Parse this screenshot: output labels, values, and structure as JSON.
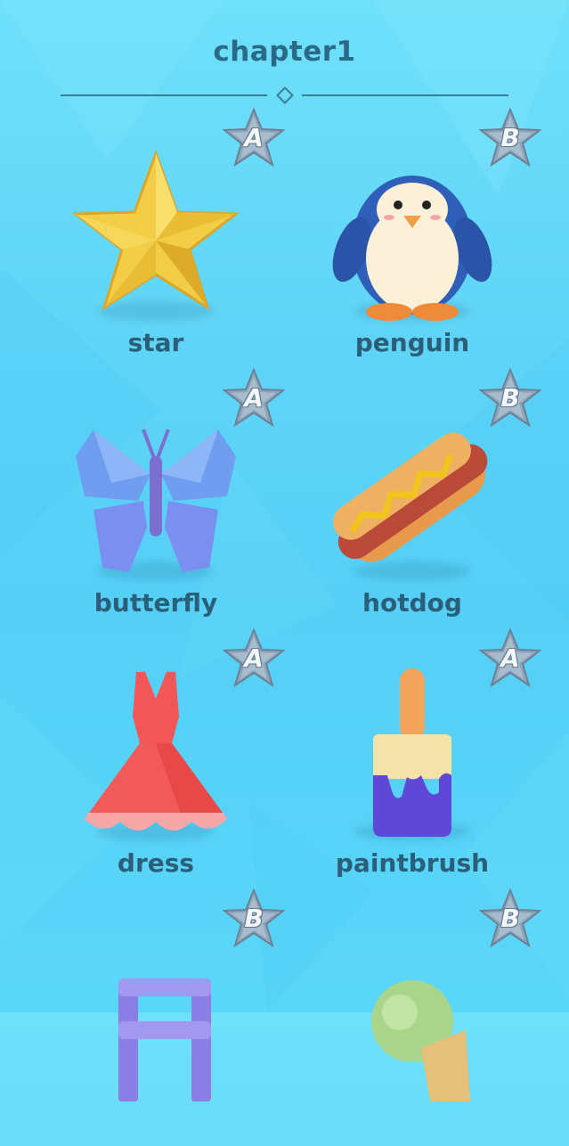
{
  "chapter": {
    "title": "chapter1"
  },
  "items": [
    {
      "label": "star",
      "grade": "A",
      "icon": "star-icon"
    },
    {
      "label": "penguin",
      "grade": "B",
      "icon": "penguin-icon"
    },
    {
      "label": "butterfly",
      "grade": "A",
      "icon": "butterfly-icon"
    },
    {
      "label": "hotdog",
      "grade": "B",
      "icon": "hotdog-icon"
    },
    {
      "label": "dress",
      "grade": "A",
      "icon": "dress-icon"
    },
    {
      "label": "paintbrush",
      "grade": "A",
      "icon": "paintbrush-icon"
    },
    {
      "label": "",
      "grade": "B",
      "icon": "ladder-icon"
    },
    {
      "label": "",
      "grade": "B",
      "icon": "ice-cream-icon"
    }
  ],
  "colors": {
    "background": "#5fd4f7",
    "title": "#2b6a86",
    "label": "#2b5e78",
    "badge_star": "#8fa6bb"
  }
}
